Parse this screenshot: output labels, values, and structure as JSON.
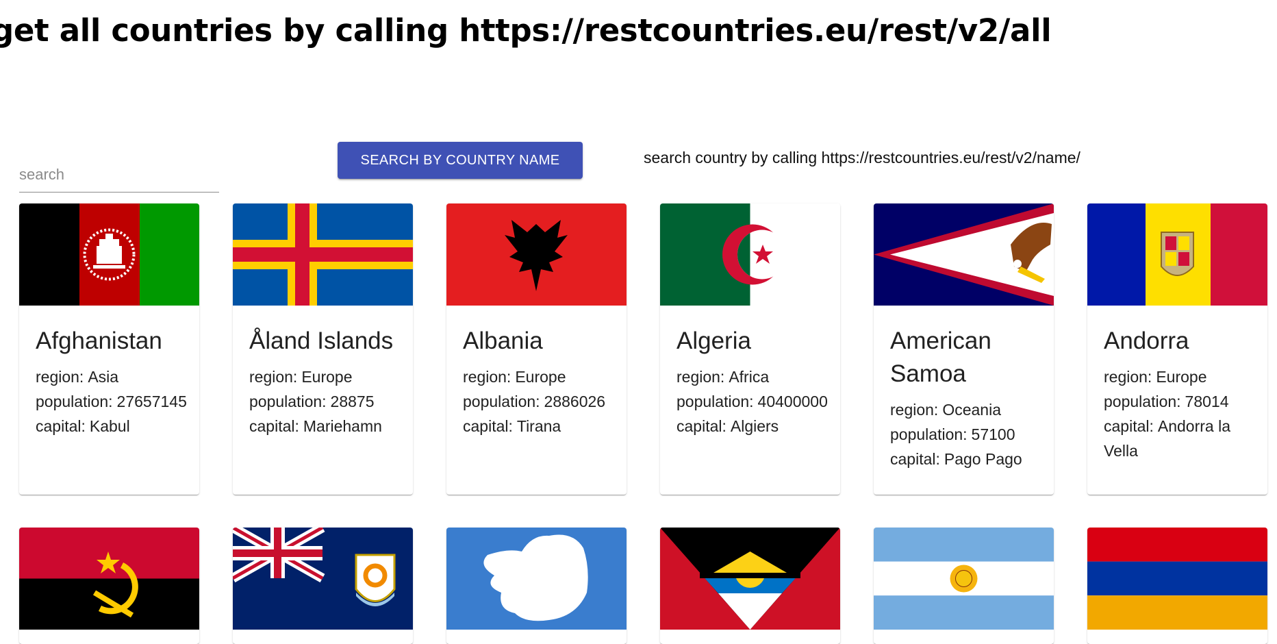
{
  "heading": "get all countries by calling https://restcountries.eu/rest/v2/all",
  "search": {
    "placeholder": "search",
    "value": ""
  },
  "search_button": {
    "label": "SEARCH BY COUNTRY NAME"
  },
  "api_note": "search country by calling https://restcountries.eu/rest/v2/name/",
  "labels": {
    "region": "region:",
    "population": "population:",
    "capital": "capital:"
  },
  "countries": [
    {
      "name": "Afghanistan",
      "region": "Asia",
      "population": "27657145",
      "capital": "Kabul",
      "flag_icon": "afghanistan-flag-icon"
    },
    {
      "name": "Åland Islands",
      "region": "Europe",
      "population": "28875",
      "capital": "Mariehamn",
      "flag_icon": "aland-islands-flag-icon"
    },
    {
      "name": "Albania",
      "region": "Europe",
      "population": "2886026",
      "capital": "Tirana",
      "flag_icon": "albania-flag-icon"
    },
    {
      "name": "Algeria",
      "region": "Africa",
      "population": "40400000",
      "capital": "Algiers",
      "flag_icon": "algeria-flag-icon"
    },
    {
      "name": "American Samoa",
      "region": "Oceania",
      "population": "57100",
      "capital": "Pago Pago",
      "flag_icon": "american-samoa-flag-icon"
    },
    {
      "name": "Andorra",
      "region": "Europe",
      "population": "78014",
      "capital": "Andorra la Vella",
      "flag_icon": "andorra-flag-icon"
    }
  ],
  "more_flags": [
    "angola-flag-icon",
    "anguilla-flag-icon",
    "antarctica-flag-icon",
    "antigua-and-barbuda-flag-icon",
    "argentina-flag-icon",
    "armenia-flag-icon"
  ],
  "colors": {
    "button": "#3f51b5",
    "divider": "#8a8a8a"
  }
}
